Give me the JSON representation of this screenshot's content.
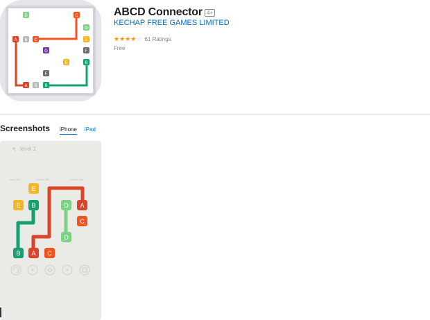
{
  "app": {
    "title": "ABCD Connector",
    "age_rating": "4+",
    "developer": "KECHAP FREE GAMES LIMITED",
    "rating_stars": 4,
    "ratings_count": "61 Ratings",
    "price": "Free"
  },
  "screenshots": {
    "heading": "Screenshots",
    "tabs": [
      {
        "label": "iPhone",
        "active": true
      },
      {
        "label": "iPad",
        "active": false
      }
    ]
  },
  "icon_tiles": [
    "D",
    "C",
    "A",
    "B",
    "C",
    "D",
    "E",
    "G",
    "F",
    "F",
    "E",
    "B",
    "A",
    "B",
    "B"
  ],
  "game_screen": {
    "level_label": "level 1",
    "stats": [
      "time 30s",
      "moves 3/5",
      "record 18s"
    ],
    "tiles": [
      "E",
      "E",
      "B",
      "D",
      "A",
      "C",
      "D",
      "B",
      "A",
      "C"
    ]
  },
  "colors": {
    "red": "#d9452b",
    "orange": "#f2531f",
    "green": "#14a06f",
    "light_green": "#7fd188",
    "yellow": "#f7b51f",
    "gray": "#6c6c6c",
    "purple": "#6e3da3",
    "link": "#0070c9"
  }
}
